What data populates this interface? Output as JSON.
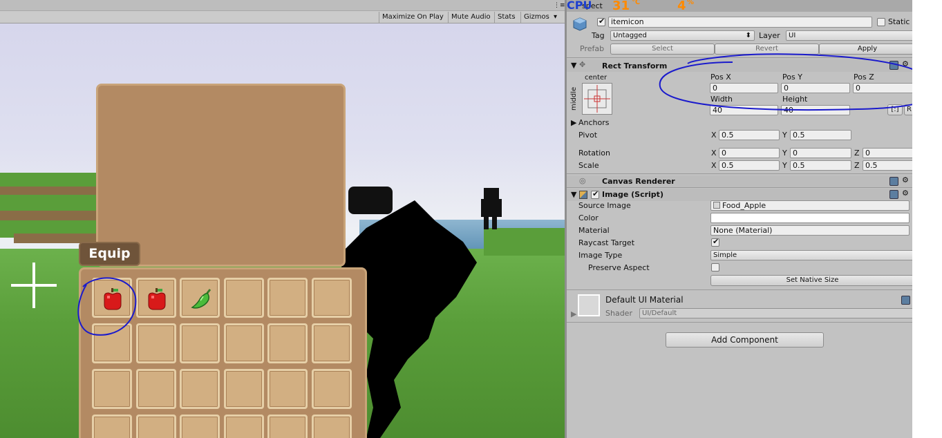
{
  "game_toolbar": {
    "buttons": [
      "Maximize On Play",
      "Mute Audio",
      "Stats",
      "Gizmos"
    ],
    "gizmos_arrow": "▾",
    "more_icon": "⋮≡"
  },
  "game": {
    "equip_label": "Equip",
    "slots": [
      "apple",
      "apple",
      "pepper",
      "",
      "",
      "",
      "",
      "",
      "",
      "",
      "",
      "",
      "",
      "",
      "",
      "",
      "",
      "",
      "",
      "",
      "",
      "",
      "",
      ""
    ]
  },
  "overlay": {
    "cpu_label": "CPU",
    "temp": "31",
    "temp_unit": "℃",
    "usage": "4",
    "usage_unit": "%",
    "tab_partial": "spect"
  },
  "inspector": {
    "object_name": "itemicon",
    "static_label": "Static",
    "tag_label": "Tag",
    "tag_value": "Untagged",
    "layer_label": "Layer",
    "layer_value": "UI",
    "prefab_label": "Prefab",
    "prefab_buttons": [
      "Select",
      "Revert",
      "Apply"
    ],
    "rect_transform": {
      "title": "Rect Transform",
      "anchor_h": "center",
      "anchor_v": "middle",
      "pos_x_label": "Pos X",
      "pos_y_label": "Pos Y",
      "pos_z_label": "Pos Z",
      "pos_x": "0",
      "pos_y": "0",
      "pos_z": "0",
      "width_label": "Width",
      "height_label": "Height",
      "width": "40",
      "height": "40",
      "blueprint_btn": "[:]",
      "raw_btn": "R",
      "anchors_label": "Anchors",
      "pivot_label": "Pivot",
      "pivot_x": "0.5",
      "pivot_y": "0.5",
      "rotation_label": "Rotation",
      "rot_x": "0",
      "rot_y": "0",
      "rot_z": "0",
      "scale_label": "Scale",
      "scale_x": "0.5",
      "scale_y": "0.5",
      "scale_z": "0.5",
      "x": "X",
      "y": "Y",
      "z": "Z"
    },
    "canvas_renderer": {
      "title": "Canvas Renderer"
    },
    "image": {
      "title": "Image (Script)",
      "source_label": "Source Image",
      "source_value": "Food_Apple",
      "color_label": "Color",
      "material_label": "Material",
      "material_value": "None (Material)",
      "raycast_label": "Raycast Target",
      "type_label": "Image Type",
      "type_value": "Simple",
      "preserve_label": "Preserve Aspect",
      "native_btn": "Set Native Size"
    },
    "material": {
      "title": "Default UI Material",
      "shader_label": "Shader",
      "shader_value": "UI/Default"
    },
    "add_component": "Add Component"
  },
  "colors": {
    "annotation": "#1a1acc",
    "panel": "#b38a63",
    "slot": "#d2af82"
  }
}
